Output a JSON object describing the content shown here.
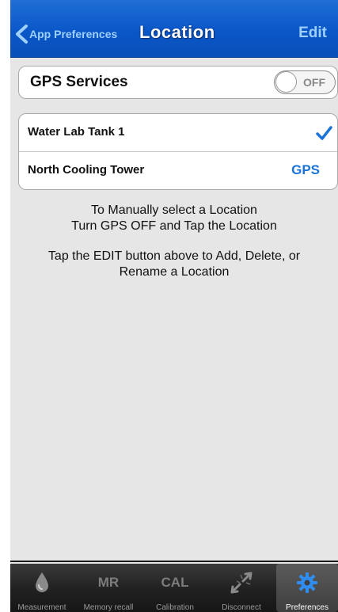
{
  "nav": {
    "back_label": "App Preferences",
    "title": "Location",
    "edit_label": "Edit"
  },
  "gps": {
    "label": "GPS Services",
    "toggle_state": "OFF"
  },
  "locations": [
    {
      "name": "Water Lab Tank 1",
      "status": "selected"
    },
    {
      "name": "North Cooling Tower",
      "tag": "GPS"
    }
  ],
  "instructions": {
    "line1": "To Manually select a Location",
    "line2": "Turn GPS OFF and Tap the Location",
    "line3": "Tap the EDIT button above to Add, Delete, or",
    "line4": "Rename a Location"
  },
  "tabbar": {
    "tabs": [
      {
        "label": "Measurement",
        "icon": "droplet-icon"
      },
      {
        "label": "Memory recall",
        "icon_text": "MR"
      },
      {
        "label": "Calibration",
        "icon_text": "CAL"
      },
      {
        "label": "Disconnect",
        "icon": "disconnect-arrows-icon"
      },
      {
        "label": "Preferences",
        "icon": "gear-icon",
        "selected": true
      }
    ]
  },
  "colors": {
    "nav_blue": "#0a57c8",
    "accent_blue": "#1a74d8",
    "link_blue": "#9fd0ff"
  }
}
